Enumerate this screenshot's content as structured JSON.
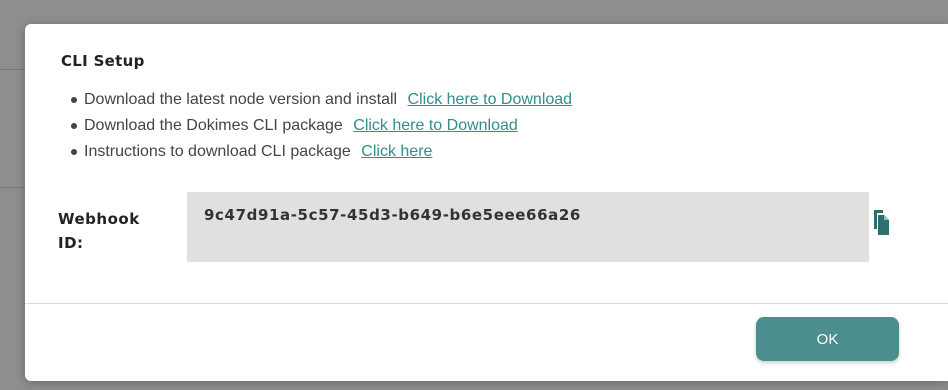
{
  "modal": {
    "title": "CLI Setup",
    "steps": [
      {
        "text": "Download the latest node version and install",
        "link": "Click here to Download"
      },
      {
        "text": "Download the Dokimes CLI package",
        "link": "Click here to Download"
      },
      {
        "text": "Instructions to download CLI package",
        "link": "Click here"
      }
    ],
    "webhook": {
      "label": "Webhook ID:",
      "value": "9c47d91a-5c57-45d3-b649-b6e5eee66a26",
      "copy_icon": "copy-icon"
    },
    "ok_label": "OK"
  },
  "colors": {
    "accent": "#4c8e8e",
    "link": "#2f8e8e",
    "id_box": "#e0e0e0",
    "backdrop": "#8e8e8e"
  }
}
